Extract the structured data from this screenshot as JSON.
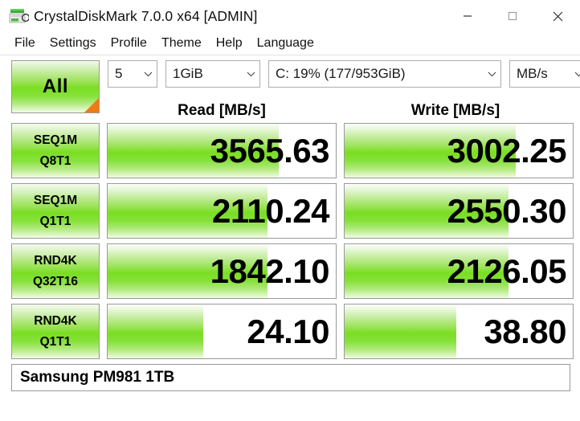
{
  "window": {
    "title": "CrystalDiskMark 7.0.0 x64 [ADMIN]",
    "icon": "disk-drive-icon",
    "minimize_label": "—",
    "maximize_label": "□",
    "close_label": "✕"
  },
  "menu": {
    "items": [
      {
        "label": "File"
      },
      {
        "label": "Settings"
      },
      {
        "label": "Profile"
      },
      {
        "label": "Theme"
      },
      {
        "label": "Help"
      },
      {
        "label": "Language"
      }
    ]
  },
  "toolbar": {
    "all_button_label": "All",
    "run_count": "5",
    "test_size": "1GiB",
    "drive": "C: 19% (177/953GiB)",
    "unit": "MB/s",
    "chevron": "⌄"
  },
  "headers": {
    "read": "Read [MB/s]",
    "write": "Write [MB/s]"
  },
  "rows": [
    {
      "test_line1": "SEQ1M",
      "test_line2": "Q8T1",
      "read_value": "3565.63",
      "read_fill_pct": "75",
      "write_value": "3002.25",
      "write_fill_pct": "75"
    },
    {
      "test_line1": "SEQ1M",
      "test_line2": "Q1T1",
      "read_value": "2110.24",
      "read_fill_pct": "70",
      "write_value": "2550.30",
      "write_fill_pct": "72"
    },
    {
      "test_line1": "RND4K",
      "test_line2": "Q32T16",
      "read_value": "1842.10",
      "read_fill_pct": "70",
      "write_value": "2126.05",
      "write_fill_pct": "72"
    },
    {
      "test_line1": "RND4K",
      "test_line2": "Q1T1",
      "read_value": "24.10",
      "read_fill_pct": "42",
      "write_value": "38.80",
      "write_fill_pct": "49"
    }
  ],
  "status": {
    "device": "Samsung PM981 1TB"
  },
  "colors": {
    "accent_green": "#7ade22",
    "corner_orange": "#f07a16",
    "border_gray": "#9a9a9a"
  }
}
